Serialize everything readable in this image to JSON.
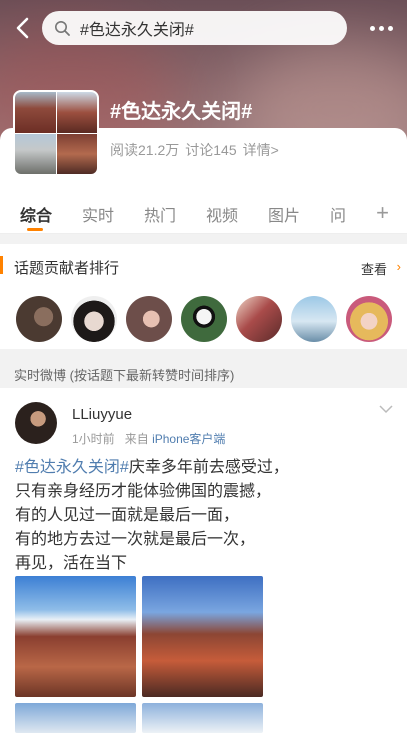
{
  "header": {
    "search_text": "#色达永久关闭#",
    "topic_title": "#色达永久关闭#",
    "read_count": "阅读21.2万",
    "discussion_count": "讨论145",
    "detail_link": "详情>"
  },
  "tabs": [
    "综合",
    "实时",
    "热门",
    "视频",
    "图片",
    "问"
  ],
  "contributors": {
    "title": "话题贡献者排行",
    "view_all": "查看",
    "avatar_colors": [
      "#6e5447",
      "#bcb6b4",
      "#b58a86",
      "#3f6a3d",
      "#a94b4a",
      "#7fb3d3",
      "#e7c67b"
    ]
  },
  "realtime": {
    "label": "实时微博 (按话题下最新转赞时间排序)"
  },
  "post": {
    "username": "LLiuyyue",
    "time": "1小时前",
    "from_prefix": "来自",
    "source": "iPhone客户端",
    "hashtag": "#色达永久关闭#",
    "line1_rest": "庆幸多年前去感受过，",
    "line2": "只有亲身经历才能体验佛国的震撼，",
    "line3": "有的人见过一面就是最后一面，",
    "line4": "有的地方去过一次就是最后一次，",
    "line5": "再见，活在当下"
  },
  "colors": {
    "accent": "#ff8200",
    "link": "#507daf"
  }
}
